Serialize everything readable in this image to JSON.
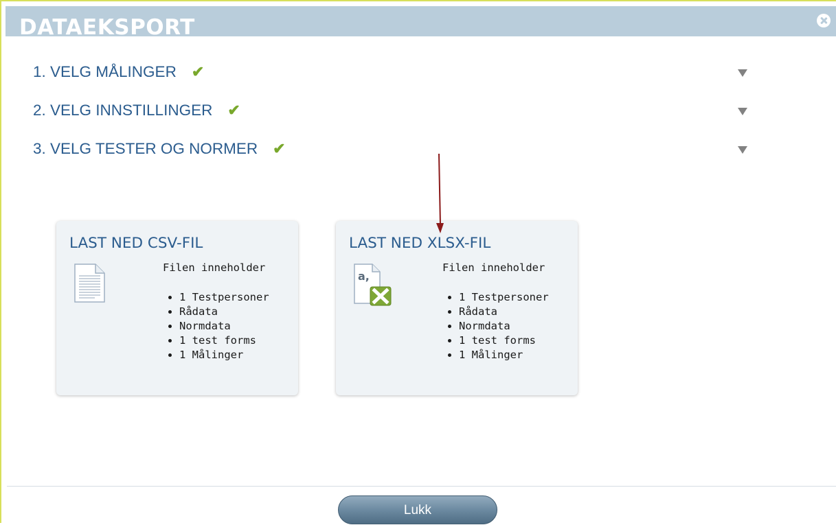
{
  "dialog": {
    "title": "DATAEKSPORT"
  },
  "steps": [
    {
      "label": "1. VELG MÅLINGER"
    },
    {
      "label": "2. VELG INNSTILLINGER"
    },
    {
      "label": "3. VELG TESTER OG NORMER"
    }
  ],
  "check_symbol": "✔",
  "colors": {
    "title_bar": "#b9cddb",
    "heading_blue": "#2b5c8e",
    "check_green": "#79a82c",
    "excel_green": "#7ea736",
    "pointer_arrow": "#8b1a1a"
  },
  "cards": [
    {
      "title": "LAST NED CSV-FIL",
      "icon": "document-icon",
      "info_heading": "Filen inneholder",
      "items": [
        "1 Testpersoner",
        "Rådata",
        "Normdata",
        "1 test forms",
        "1 Målinger"
      ]
    },
    {
      "title": "LAST NED XLSX-FIL",
      "icon": "excel-file-icon",
      "icon_text": "a,",
      "info_heading": "Filen inneholder",
      "items": [
        "1 Testpersoner",
        "Rådata",
        "Normdata",
        "1 test forms",
        "1 Målinger"
      ]
    }
  ],
  "footer": {
    "close_label": "Lukk"
  }
}
